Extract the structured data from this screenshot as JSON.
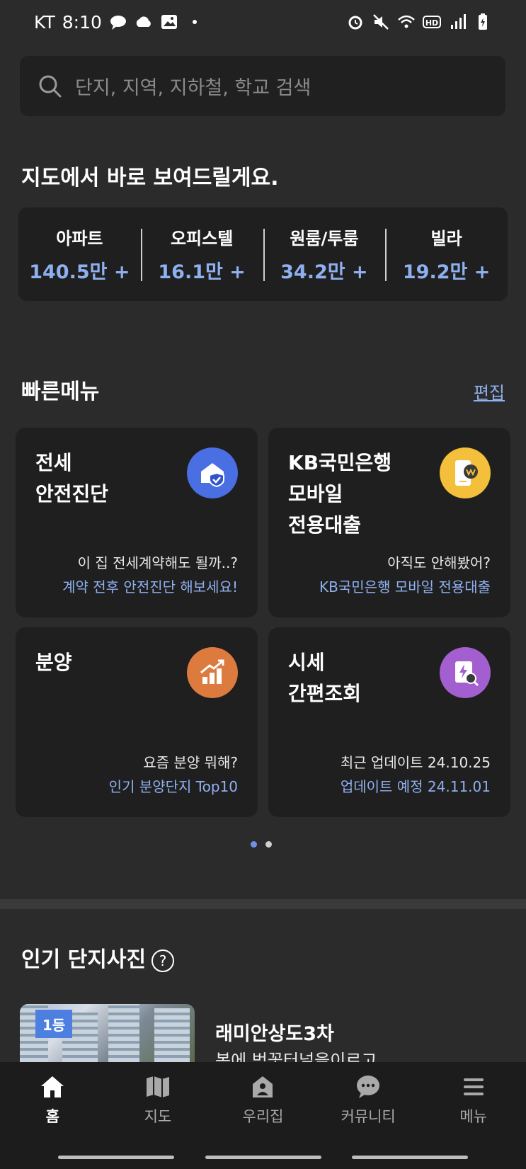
{
  "status_bar": {
    "carrier": "KT",
    "time": "8:10"
  },
  "search": {
    "placeholder": "단지, 지역, 지하철, 학교 검색"
  },
  "map_section": {
    "title": "지도에서 바로 보여드릴게요.",
    "items": [
      {
        "label": "아파트",
        "value": "140.5만 +"
      },
      {
        "label": "오피스텔",
        "value": "16.1만 +"
      },
      {
        "label": "원룸/투룸",
        "value": "34.2만 +"
      },
      {
        "label": "빌라",
        "value": "19.2만 +"
      }
    ]
  },
  "quick_menu": {
    "title": "빠른메뉴",
    "edit_label": "편집",
    "cards": [
      {
        "title": "전세\n안전진단",
        "sub1": "이 집 전세계약해도 될까..?",
        "sub2": "계약 전후 안전진단 해보세요!",
        "icon": "house-shield-icon",
        "color": "#4a6fe3"
      },
      {
        "title": "KB국민은행\n모바일\n전용대출",
        "sub1": "아직도 안해봤어?",
        "sub2": "KB국민은행 모바일 전용대출",
        "icon": "phone-loan-icon",
        "color": "#f4bf3a"
      },
      {
        "title": "분양",
        "sub1": "요즘 분양 뭐해?",
        "sub2": "인기 분양단지 Top10",
        "icon": "growth-chart-icon",
        "color": "#dd7a3e"
      },
      {
        "title": "시세\n간편조회",
        "sub1": "최근 업데이트 24.10.25",
        "sub2": "업데이트 예정 24.11.01",
        "icon": "price-search-icon",
        "color": "#a35fd0"
      }
    ],
    "page_count": 2,
    "active_page": 1
  },
  "popular_photos": {
    "title": "인기 단지사진",
    "rank": "1등",
    "complex_name": "래미안상도3차",
    "description": "봄에 벚꽃터널을이르고"
  },
  "bottom_nav": [
    {
      "label": "홈",
      "icon": "home-icon",
      "active": true
    },
    {
      "label": "지도",
      "icon": "map-icon",
      "active": false
    },
    {
      "label": "우리집",
      "icon": "my-house-icon",
      "active": false
    },
    {
      "label": "커뮤니티",
      "icon": "chat-bubble-icon",
      "active": false
    },
    {
      "label": "메뉴",
      "icon": "hamburger-menu-icon",
      "active": false
    }
  ]
}
